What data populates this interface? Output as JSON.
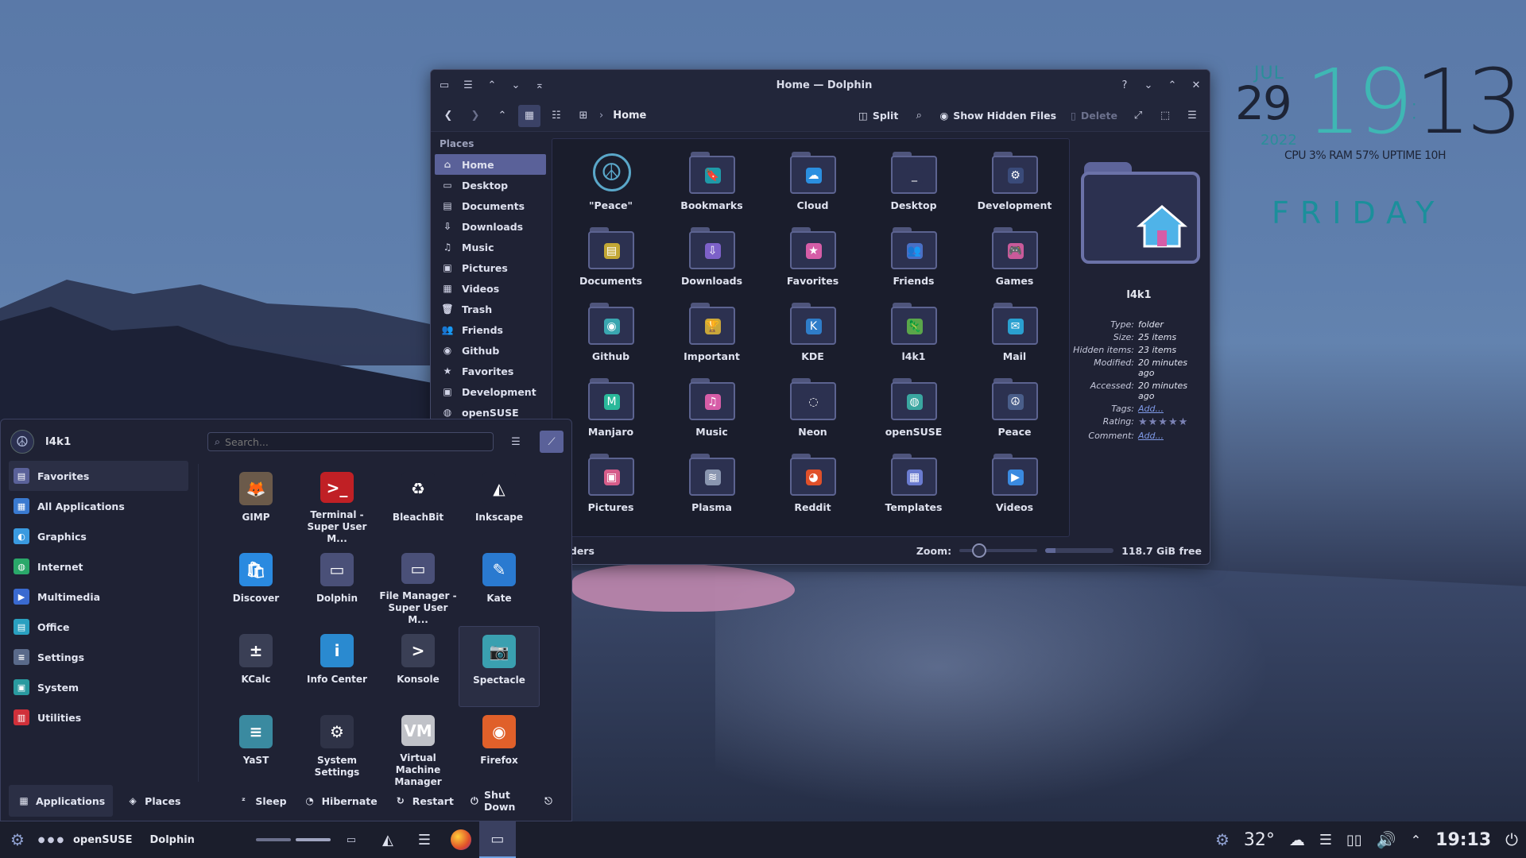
{
  "clock_widget": {
    "month": "JUL",
    "day": "29",
    "year": "2022",
    "hour": "19",
    "minute": "13",
    "stats": "CPU 3% RAM 57% UPTIME 10H",
    "weekday": "FRIDAY",
    "accent": "#2b8e9a"
  },
  "dolphin": {
    "title": "Home — Dolphin",
    "breadcrumb": "Home",
    "split_label": "Split",
    "hidden_label": "Show Hidden Files",
    "delete_label": "Delete",
    "places_header": "Places",
    "places": [
      {
        "label": "Home",
        "icon": "home-icon",
        "glyph": "⌂",
        "selected": true
      },
      {
        "label": "Desktop",
        "icon": "desktop-icon",
        "glyph": "▭",
        "selected": false
      },
      {
        "label": "Documents",
        "icon": "documents-icon",
        "glyph": "▤",
        "selected": false
      },
      {
        "label": "Downloads",
        "icon": "download-icon",
        "glyph": "⇩",
        "selected": false
      },
      {
        "label": "Music",
        "icon": "music-icon",
        "glyph": "♫",
        "selected": false
      },
      {
        "label": "Pictures",
        "icon": "pictures-icon",
        "glyph": "▣",
        "selected": false
      },
      {
        "label": "Videos",
        "icon": "videos-icon",
        "glyph": "▦",
        "selected": false
      },
      {
        "label": "Trash",
        "icon": "trash-icon",
        "glyph": "🗑",
        "selected": false
      },
      {
        "label": "Friends",
        "icon": "friends-icon",
        "glyph": "👥",
        "selected": false
      },
      {
        "label": "Github",
        "icon": "github-icon",
        "glyph": "◉",
        "selected": false
      },
      {
        "label": "Favorites",
        "icon": "star-icon",
        "glyph": "★",
        "selected": false
      },
      {
        "label": "Development",
        "icon": "development-icon",
        "glyph": "▣",
        "selected": false
      },
      {
        "label": "openSUSE",
        "icon": "opensuse-icon",
        "glyph": "◍",
        "selected": false
      }
    ],
    "files": [
      {
        "label": "\"Peace\"",
        "emblem": "peace-icon",
        "glyph": "☮",
        "color": "#5aa7c9",
        "plain": true
      },
      {
        "label": "Bookmarks",
        "emblem": "bookmark-icon",
        "glyph": "🔖",
        "color": "#1f9aa8"
      },
      {
        "label": "Cloud",
        "emblem": "cloud-icon",
        "glyph": "☁",
        "color": "#2b8fe0"
      },
      {
        "label": "Desktop",
        "emblem": "desktop-icon",
        "glyph": "_",
        "color": "#2c3150"
      },
      {
        "label": "Development",
        "emblem": "gear-icon",
        "glyph": "⚙",
        "color": "#3a4b7a"
      },
      {
        "label": "Documents",
        "emblem": "documents-icon",
        "glyph": "▤",
        "color": "#c2a735"
      },
      {
        "label": "Downloads",
        "emblem": "download-icon",
        "glyph": "⇩",
        "color": "#7d61c9"
      },
      {
        "label": "Favorites",
        "emblem": "star-icon",
        "glyph": "★",
        "color": "#d65da7"
      },
      {
        "label": "Friends",
        "emblem": "friends-icon",
        "glyph": "👥",
        "color": "#4a6fc4"
      },
      {
        "label": "Games",
        "emblem": "gamepad-icon",
        "glyph": "🎮",
        "color": "#c95a9a"
      },
      {
        "label": "Github",
        "emblem": "github-icon",
        "glyph": "◉",
        "color": "#3aa6b0"
      },
      {
        "label": "Important",
        "emblem": "trophy-icon",
        "glyph": "🏆",
        "color": "#c9a63a"
      },
      {
        "label": "KDE",
        "emblem": "kde-icon",
        "glyph": "K",
        "color": "#2f7dc9"
      },
      {
        "label": "l4k1",
        "emblem": "chameleon-icon",
        "glyph": "🦎",
        "color": "#5aa64a"
      },
      {
        "label": "Mail",
        "emblem": "mail-icon",
        "glyph": "✉",
        "color": "#2aa0d0"
      },
      {
        "label": "Manjaro",
        "emblem": "manjaro-icon",
        "glyph": "M",
        "color": "#2ab89a"
      },
      {
        "label": "Music",
        "emblem": "music-icon",
        "glyph": "♫",
        "color": "#d65da7"
      },
      {
        "label": "Neon",
        "emblem": "neon-icon",
        "glyph": "◌",
        "color": "#2c3150"
      },
      {
        "label": "openSUSE",
        "emblem": "opensuse-icon",
        "glyph": "◍",
        "color": "#3aa6a0"
      },
      {
        "label": "Peace",
        "emblem": "peace-icon",
        "glyph": "☮",
        "color": "#4a5e8a"
      },
      {
        "label": "Pictures",
        "emblem": "pictures-icon",
        "glyph": "▣",
        "color": "#d65d8a"
      },
      {
        "label": "Plasma",
        "emblem": "plasma-icon",
        "glyph": "≋",
        "color": "#8a96b0"
      },
      {
        "label": "Reddit",
        "emblem": "reddit-icon",
        "glyph": "◕",
        "color": "#e0502a"
      },
      {
        "label": "Templates",
        "emblem": "templates-icon",
        "glyph": "▦",
        "color": "#6a7bd0"
      },
      {
        "label": "Videos",
        "emblem": "videos-icon",
        "glyph": "▶",
        "color": "#3a8ae0"
      }
    ],
    "status_text": "olders",
    "zoom_label": "Zoom:",
    "zoom_level": 0.2,
    "free_space": "118.7 GiB free",
    "used_fraction": 0.15,
    "info": {
      "name": "l4k1",
      "type_key": "Type:",
      "type": "folder",
      "size_key": "Size:",
      "size": "25 items",
      "hidden_key": "Hidden items:",
      "hidden": "23 items",
      "modified_key": "Modified:",
      "modified": "20 minutes ago",
      "accessed_key": "Accessed:",
      "accessed": "20 minutes ago",
      "tags_key": "Tags:",
      "tags": "Add...",
      "rating_key": "Rating:",
      "rating": 0,
      "comment_key": "Comment:",
      "comment": "Add..."
    }
  },
  "launcher": {
    "user": "l4k1",
    "search_placeholder": "Search...",
    "categories": [
      {
        "label": "Favorites",
        "icon": "favorites-icon",
        "color": "#5a6199",
        "glyph": "▤",
        "selected": true
      },
      {
        "label": "All Applications",
        "icon": "grid-icon",
        "color": "#3a7ad0",
        "glyph": "▦",
        "selected": false
      },
      {
        "label": "Graphics",
        "icon": "graphics-icon",
        "color": "#3a9ae0",
        "glyph": "◐",
        "selected": false
      },
      {
        "label": "Internet",
        "icon": "globe-icon",
        "color": "#2aa86a",
        "glyph": "◍",
        "selected": false
      },
      {
        "label": "Multimedia",
        "icon": "multimedia-icon",
        "color": "#3a6ad0",
        "glyph": "▶",
        "selected": false
      },
      {
        "label": "Office",
        "icon": "office-icon",
        "color": "#2aa0c0",
        "glyph": "▤",
        "selected": false
      },
      {
        "label": "Settings",
        "icon": "settings-icon",
        "color": "#5a6a8a",
        "glyph": "≡",
        "selected": false
      },
      {
        "label": "System",
        "icon": "system-icon",
        "color": "#2a9aa0",
        "glyph": "▣",
        "selected": false
      },
      {
        "label": "Utilities",
        "icon": "utilities-icon",
        "color": "#d0303a",
        "glyph": "▥",
        "selected": false
      }
    ],
    "apps": [
      {
        "label": "GIMP",
        "icon": "gimp-icon",
        "color": "#6b5a4a",
        "glyph": "🦊",
        "selected": false
      },
      {
        "label": "Terminal - Super User M...",
        "icon": "terminal-root-icon",
        "color": "#c02025",
        "glyph": ">_",
        "selected": false
      },
      {
        "label": "BleachBit",
        "icon": "bleachbit-icon",
        "color": "#1f2234",
        "glyph": "♻",
        "selected": false
      },
      {
        "label": "Inkscape",
        "icon": "inkscape-icon",
        "color": "#1f2234",
        "glyph": "◭",
        "selected": false
      },
      {
        "label": "Discover",
        "icon": "discover-icon",
        "color": "#2a8ae0",
        "glyph": "🛍",
        "selected": false
      },
      {
        "label": "Dolphin",
        "icon": "dolphin-icon",
        "color": "#4a5078",
        "glyph": "▭",
        "selected": false
      },
      {
        "label": "File Manager - Super User M...",
        "icon": "file-manager-root-icon",
        "color": "#4a5078",
        "glyph": "▭",
        "selected": false
      },
      {
        "label": "Kate",
        "icon": "kate-icon",
        "color": "#2a7ad0",
        "glyph": "✎",
        "selected": false
      },
      {
        "label": "KCalc",
        "icon": "kcalc-icon",
        "color": "#3a3f55",
        "glyph": "±",
        "selected": false
      },
      {
        "label": "Info Center",
        "icon": "info-icon",
        "color": "#2a8ad0",
        "glyph": "i",
        "selected": false
      },
      {
        "label": "Konsole",
        "icon": "konsole-icon",
        "color": "#3a3f55",
        "glyph": ">",
        "selected": false
      },
      {
        "label": "Spectacle",
        "icon": "spectacle-icon",
        "color": "#3aa0b0",
        "glyph": "📷",
        "selected": true
      },
      {
        "label": "YaST",
        "icon": "yast-icon",
        "color": "#3a8aa0",
        "glyph": "≡",
        "selected": false
      },
      {
        "label": "System Settings",
        "icon": "system-settings-icon",
        "color": "#2f3347",
        "glyph": "⚙",
        "selected": false
      },
      {
        "label": "Virtual Machine Manager",
        "icon": "virt-manager-icon",
        "color": "#c0c2c8",
        "glyph": "VM",
        "selected": false
      },
      {
        "label": "Firefox",
        "icon": "firefox-icon",
        "color": "#e0602a",
        "glyph": "◉",
        "selected": false
      }
    ],
    "bottom": {
      "applications": "Applications",
      "places": "Places",
      "sleep": "Sleep",
      "hibernate": "Hibernate",
      "restart": "Restart",
      "shutdown": "Shut Down"
    }
  },
  "taskbar": {
    "activity": "openSUSE",
    "window": "Dolphin",
    "temperature": "32°",
    "time": "19:13"
  }
}
